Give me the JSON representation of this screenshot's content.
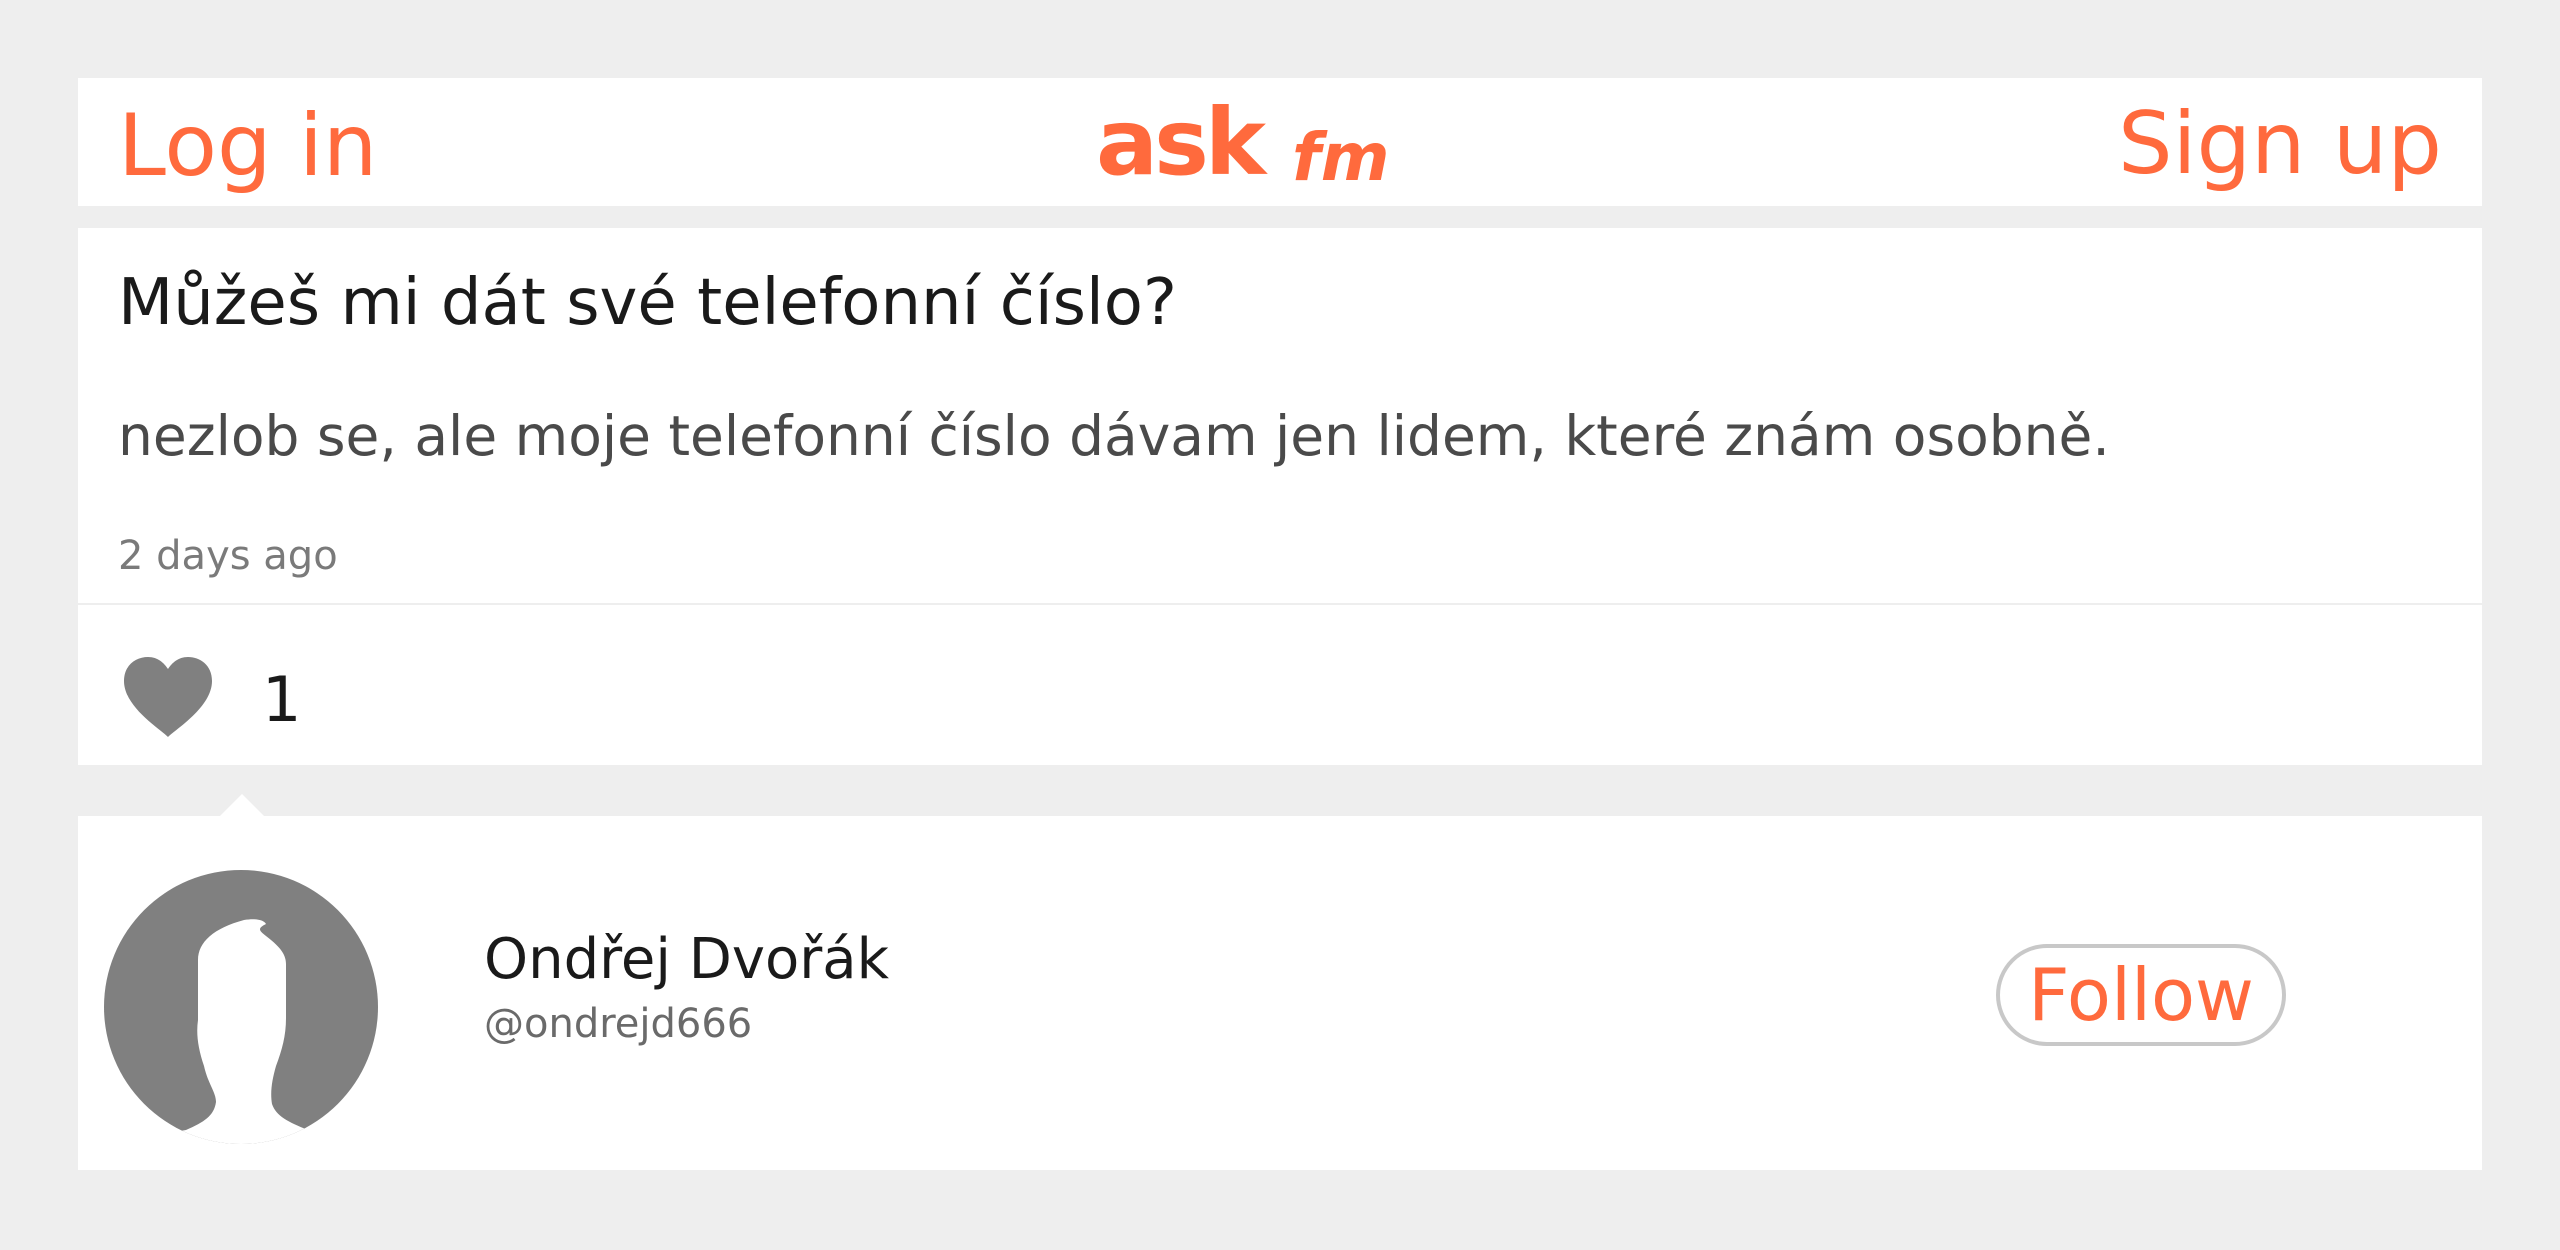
{
  "header": {
    "login_label": "Log in",
    "signup_label": "Sign up",
    "logo_text": "ASKfm",
    "brand_color": "#ff6a3d"
  },
  "question": {
    "text": "Můžeš mi dát své telefonní číslo?",
    "answer": "nezlob se, ale moje telefonní číslo dávam jen lidem, které znám osobně.",
    "time_ago": "2 days ago"
  },
  "likes": {
    "icon": "heart-icon",
    "count": "1"
  },
  "profile": {
    "name": "Ondřej Dvořák",
    "handle": "@ondrejd666",
    "follow_label": "Follow",
    "avatar_icon": "default-avatar-silhouette"
  }
}
